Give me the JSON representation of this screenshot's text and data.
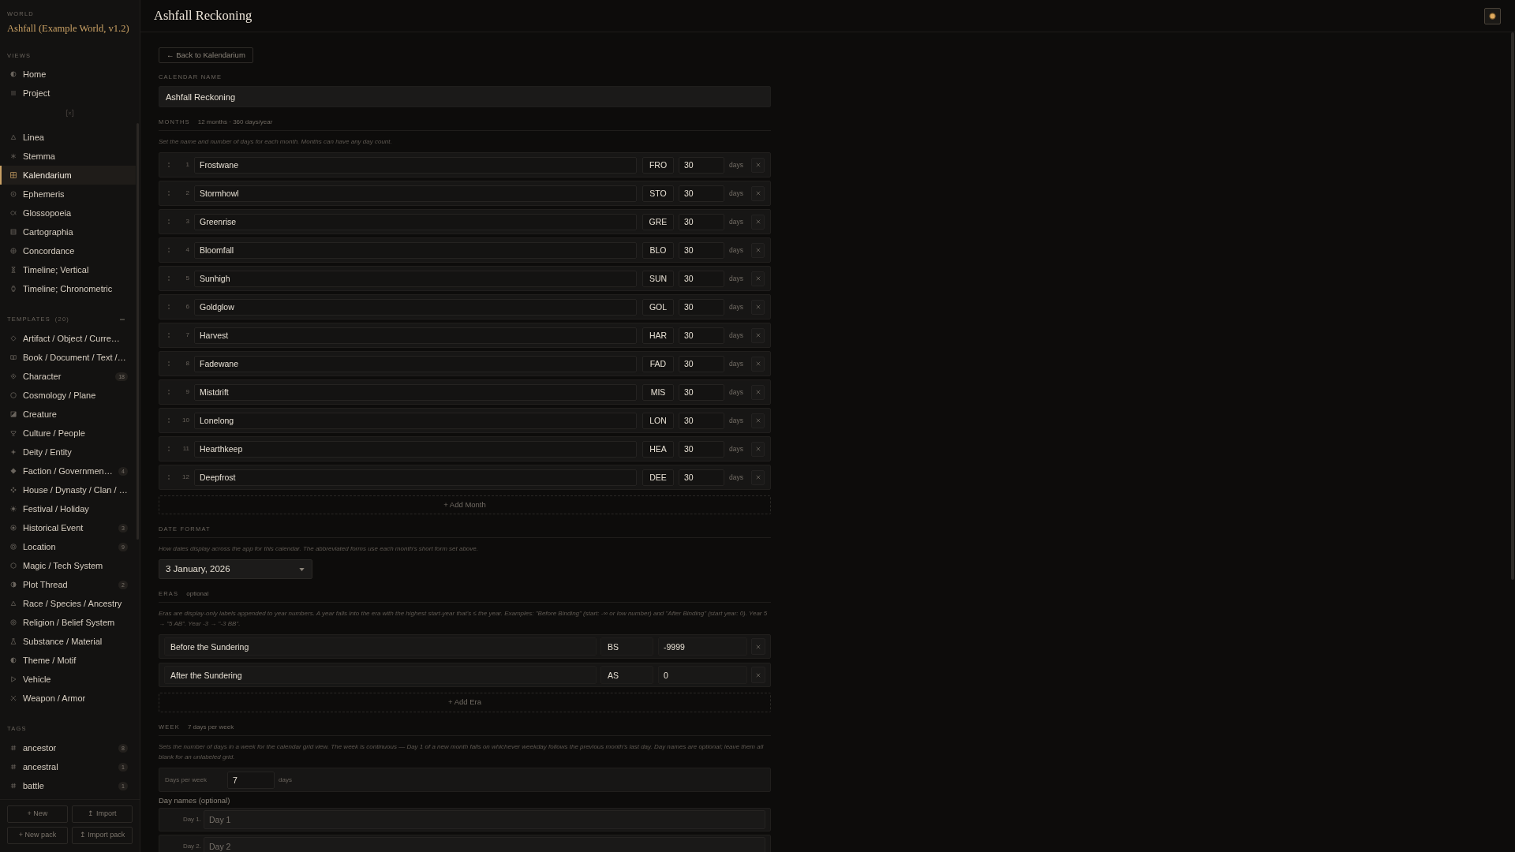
{
  "sidebar": {
    "world_label": "WORLD",
    "world_name": "Ashfall (Example World, v1.2)",
    "views_label": "VIEWS",
    "views": [
      {
        "label": "Home",
        "selected": false
      },
      {
        "label": "Project",
        "selected": false
      }
    ],
    "tools": [
      {
        "label": "Linea",
        "selected": false
      },
      {
        "label": "Stemma",
        "selected": false
      },
      {
        "label": "Kalendarium",
        "selected": true
      },
      {
        "label": "Ephemeris",
        "selected": false
      },
      {
        "label": "Glossopoeia",
        "selected": false
      },
      {
        "label": "Cartographia",
        "selected": false
      },
      {
        "label": "Concordance",
        "selected": false
      },
      {
        "label": "Timeline; Vertical",
        "selected": false
      },
      {
        "label": "Timeline; Chronometric",
        "selected": false
      }
    ],
    "templates_label": "TEMPLATES",
    "templates_count": "(20)",
    "templates": [
      {
        "label": "Artifact / Object / Curre…"
      },
      {
        "label": "Book / Document / Text /…"
      },
      {
        "label": "Character",
        "count": "18"
      },
      {
        "label": "Cosmology / Plane"
      },
      {
        "label": "Creature"
      },
      {
        "label": "Culture / People"
      },
      {
        "label": "Deity / Entity"
      },
      {
        "label": "Faction / Governmen…",
        "count": "4"
      },
      {
        "label": "House / Dynasty / Clan / …"
      },
      {
        "label": "Festival / Holiday"
      },
      {
        "label": "Historical Event",
        "count": "3"
      },
      {
        "label": "Location",
        "count": "9"
      },
      {
        "label": "Magic / Tech System"
      },
      {
        "label": "Plot Thread",
        "count": "2"
      },
      {
        "label": "Race / Species / Ancestry"
      },
      {
        "label": "Religion / Belief System"
      },
      {
        "label": "Substance / Material"
      },
      {
        "label": "Theme / Motif"
      },
      {
        "label": "Vehicle"
      },
      {
        "label": "Weapon / Armor"
      }
    ],
    "tags_label": "TAGS",
    "tags": [
      {
        "label": "ancestor",
        "count": "8"
      },
      {
        "label": "ancestral",
        "count": "1"
      },
      {
        "label": "battle",
        "count": "1"
      }
    ],
    "actions": [
      "+ New",
      "↥ Import",
      "+ New pack",
      "↥ Import pack"
    ]
  },
  "header": {
    "title": "Ashfall Reckoning"
  },
  "back_button": "← Back to Kalendarium",
  "calendar_name": {
    "label": "CALENDAR NAME",
    "value": "Ashfall Reckoning"
  },
  "months": {
    "label": "MONTHS",
    "summary": "12 months · 360 days/year",
    "hint": "Set the name and number of days for each month. Months can have any day count.",
    "rows": [
      {
        "number": "1",
        "name": "Frostwane",
        "abbr": "FRO",
        "days": "30",
        "unit": "days"
      },
      {
        "number": "2",
        "name": "Stormhowl",
        "abbr": "STO",
        "days": "30",
        "unit": "days"
      },
      {
        "number": "3",
        "name": "Greenrise",
        "abbr": "GRE",
        "days": "30",
        "unit": "days"
      },
      {
        "number": "4",
        "name": "Bloomfall",
        "abbr": "BLO",
        "days": "30",
        "unit": "days"
      },
      {
        "number": "5",
        "name": "Sunhigh",
        "abbr": "SUN",
        "days": "30",
        "unit": "days"
      },
      {
        "number": "6",
        "name": "Goldglow",
        "abbr": "GOL",
        "days": "30",
        "unit": "days"
      },
      {
        "number": "7",
        "name": "Harvest",
        "abbr": "HAR",
        "days": "30",
        "unit": "days"
      },
      {
        "number": "8",
        "name": "Fadewane",
        "abbr": "FAD",
        "days": "30",
        "unit": "days"
      },
      {
        "number": "9",
        "name": "Mistdrift",
        "abbr": "MIS",
        "days": "30",
        "unit": "days"
      },
      {
        "number": "10",
        "name": "Lonelong",
        "abbr": "LON",
        "days": "30",
        "unit": "days"
      },
      {
        "number": "11",
        "name": "Hearthkeep",
        "abbr": "HEA",
        "days": "30",
        "unit": "days"
      },
      {
        "number": "12",
        "name": "Deepfrost",
        "abbr": "DEE",
        "days": "30",
        "unit": "days"
      }
    ],
    "add_button": "+ Add Month"
  },
  "date_format": {
    "label": "DATE FORMAT",
    "hint": "How dates display across the app for this calendar. The abbreviated forms use each month's short form set above.",
    "value": "3 January, 2026"
  },
  "eras": {
    "label": "ERAS",
    "note": "optional",
    "hint": "Eras are display-only labels appended to year numbers. A year falls into the era with the highest start-year that's ≤ the year. Examples: \"Before Binding\" (start: -∞ or low number) and \"After Binding\" (start year: 0). Year 5 → \"5 AB\". Year -3 → \"-3 BB\".",
    "rows": [
      {
        "name": "Before the Sundering",
        "abbr": "BS",
        "start": "-9999"
      },
      {
        "name": "After the Sundering",
        "abbr": "AS",
        "start": "0"
      }
    ],
    "add_button": "+ Add Era"
  },
  "week": {
    "label": "WEEK",
    "summary": "7 days per week",
    "hint": "Sets the number of days in a week for the calendar grid view. The week is continuous — Day 1 of a new month falls on whichever weekday follows the previous month's last day. Day names are optional; leave them all blank for an unlabeled grid.",
    "days_per_week": {
      "label": "Days per week",
      "value": "7",
      "unit": "days"
    },
    "day_names_label": "Day names (optional)",
    "day_names": [
      {
        "label": "Day 1.",
        "placeholder": "Day 1"
      },
      {
        "label": "Day 2.",
        "placeholder": "Day 2"
      }
    ]
  }
}
